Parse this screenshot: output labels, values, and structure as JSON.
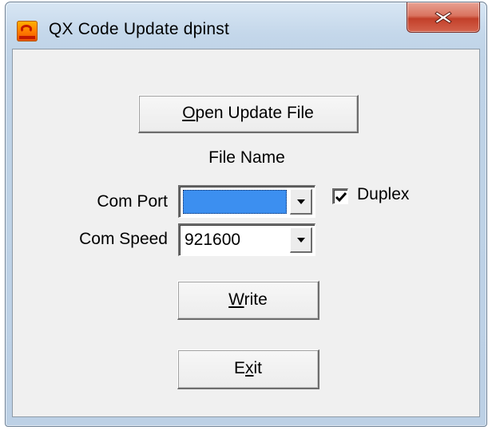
{
  "window": {
    "title": "QX Code Update dpinst"
  },
  "buttons": {
    "open_update_file": {
      "mnemonic": "O",
      "rest": "pen Update File"
    },
    "write": {
      "mnemonic": "W",
      "rest": "rite"
    },
    "exit": {
      "before": "E",
      "mnemonic": "x",
      "rest": "it"
    }
  },
  "file_name_label": "File Name",
  "com_port": {
    "label": "Com Port",
    "value": ""
  },
  "com_speed": {
    "label": "Com Speed",
    "value": "921600"
  },
  "duplex": {
    "label": "Duplex",
    "checked": true
  },
  "icons": {
    "app": "qx-app-icon",
    "close": "close-icon",
    "dropdown": "chevron-down-icon",
    "check": "checkmark-icon"
  },
  "colors": {
    "selection": "#3c8ff0",
    "close_button": "#c2402a",
    "window_frame": "#c4d7ea"
  }
}
